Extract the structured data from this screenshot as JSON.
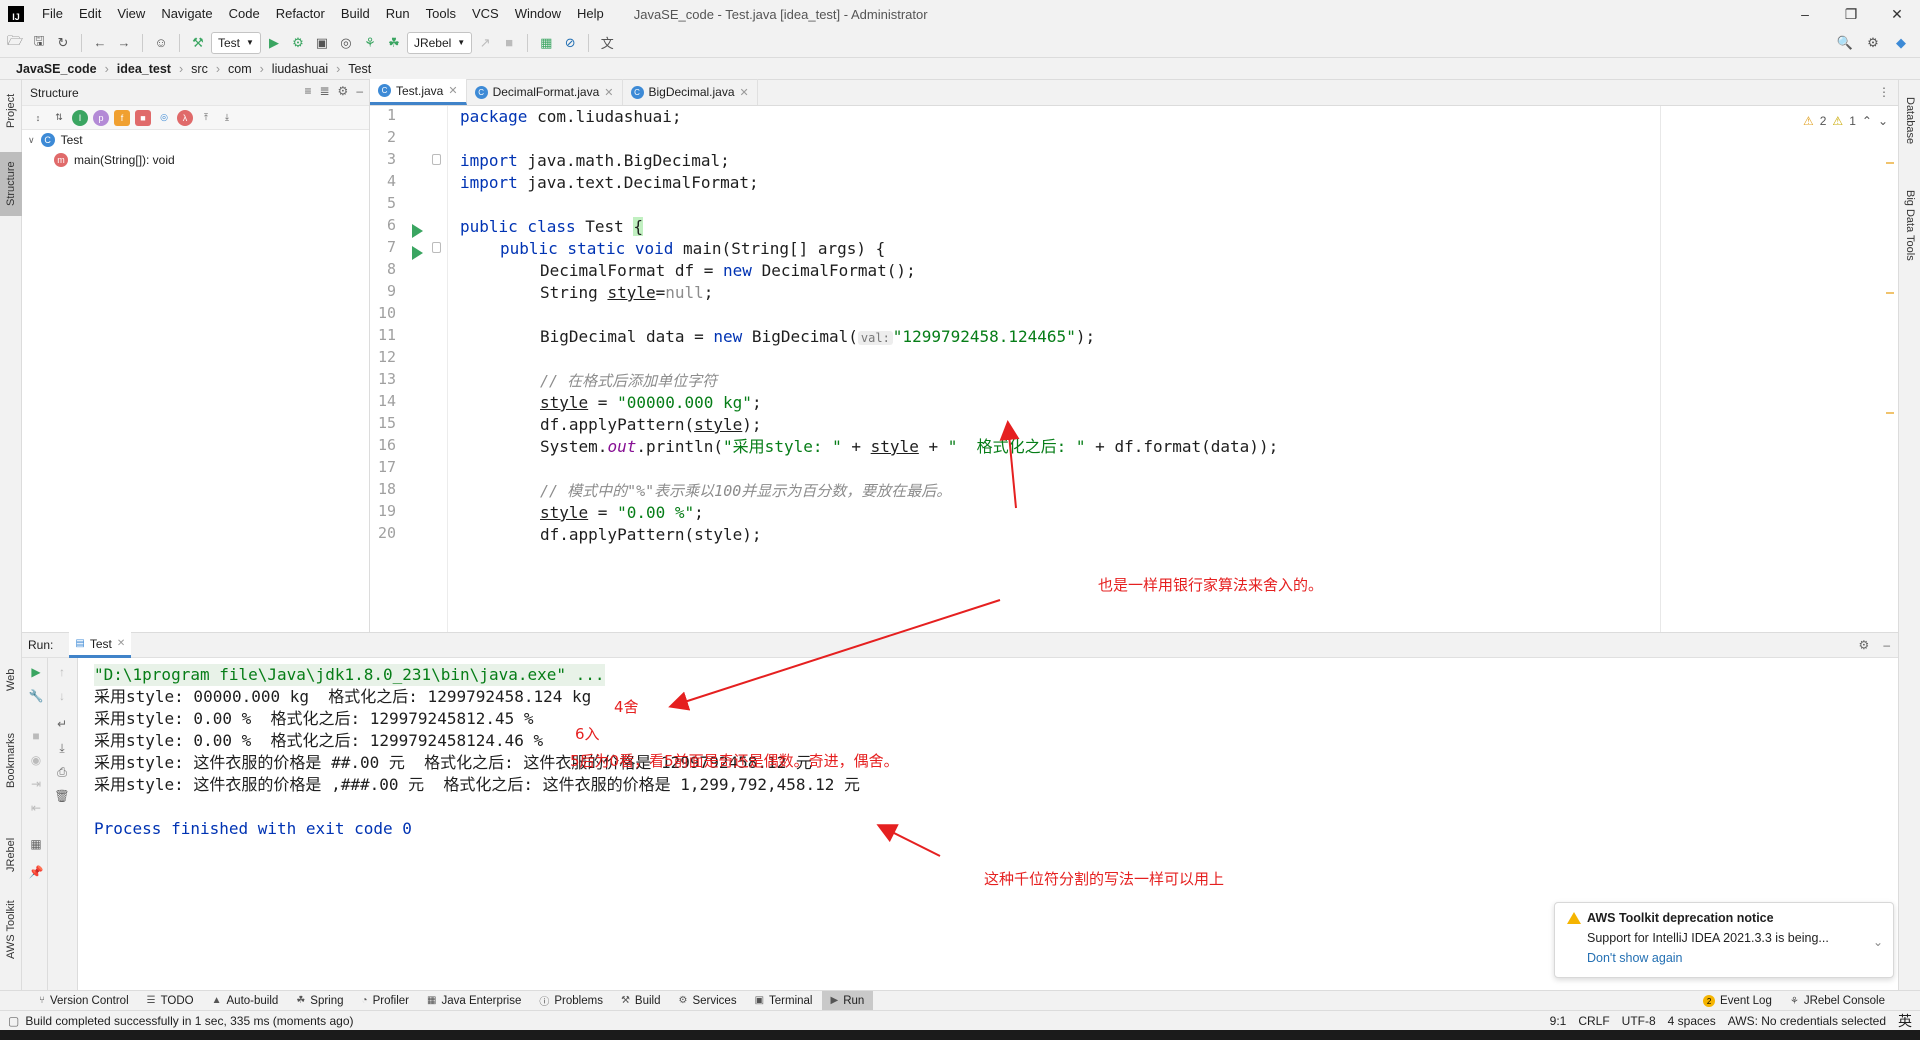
{
  "window": {
    "title": "JavaSE_code - Test.java [idea_test] - Administrator",
    "logo": "IJ"
  },
  "menu": [
    "File",
    "Edit",
    "View",
    "Navigate",
    "Code",
    "Refactor",
    "Build",
    "Run",
    "Tools",
    "VCS",
    "Window",
    "Help"
  ],
  "toolbar": {
    "run_config": "Test",
    "jrebel": "JRebel"
  },
  "breadcrumb": [
    "JavaSE_code",
    "idea_test",
    "src",
    "com",
    "liudashuai",
    "Test"
  ],
  "left_stripe": {
    "project": "Project",
    "structure": "Structure",
    "web": "Web",
    "bookmarks": "Bookmarks",
    "jrebel": "JRebel",
    "aws": "AWS Toolkit"
  },
  "right_stripe": {
    "database": "Database",
    "bigdata": "Big Data Tools"
  },
  "structure": {
    "title": "Structure",
    "root": "Test",
    "child": "main(String[]): void"
  },
  "editor": {
    "tabs": [
      "Test.java",
      "DecimalFormat.java",
      "BigDecimal.java"
    ],
    "inspections": {
      "warnings": "2",
      "weak": "1"
    },
    "line_numbers": [
      "1",
      "2",
      "3",
      "4",
      "5",
      "6",
      "7",
      "8",
      "9",
      "10",
      "11",
      "12",
      "13",
      "14",
      "15",
      "16",
      "17",
      "18",
      "19",
      "20"
    ],
    "code": {
      "l1_kw": "package",
      "l1_rest": " com.liudashuai;",
      "l3_kw": "import",
      "l3_rest": " java.math.BigDecimal;",
      "l4_kw": "import",
      "l4_rest": " java.text.DecimalFormat;",
      "l6_kw": "public class",
      "l6_name": " Test ",
      "l6_brace": "{",
      "l7_kw": "public static void",
      "l7_rest": " main(String[] args) {",
      "l8_a": "DecimalFormat df = ",
      "l8_kw": "new",
      "l8_b": " DecimalFormat();",
      "l9_a": "String ",
      "l9_var": "style",
      "l9_b": "=",
      "l9_null": "null",
      "l9_c": ";",
      "l11_a": "BigDecimal data = ",
      "l11_kw": "new",
      "l11_b": " BigDecimal(",
      "l11_hint": "val:",
      "l11_str": "\"1299792458.124465\"",
      "l11_c": ");",
      "l13": "// 在格式后添加单位字符",
      "l14_var": "style",
      "l14_a": " = ",
      "l14_str": "\"00000.000 kg\"",
      "l14_b": ";",
      "l15_a": "df.applyPattern(",
      "l15_var": "style",
      "l15_b": ");",
      "l16_a": "System.",
      "l16_out": "out",
      "l16_b": ".println(",
      "l16_s1": "\"采用style: \"",
      "l16_c": " + ",
      "l16_var": "style",
      "l16_d": " + ",
      "l16_s2": "\"  格式化之后: \"",
      "l16_e": " + df.format(data));",
      "l18": "// 模式中的\"%\"表示乘以100并显示为百分数，要放在最后。",
      "l19_var": "style",
      "l19_a": " = ",
      "l19_str": "\"0.00 %\"",
      "l19_b": ";",
      "l20": "df.applyPattern(style);"
    }
  },
  "run": {
    "label": "Run:",
    "tab": "Test",
    "output": [
      "\"D:\\1program file\\Java\\jdk1.8.0_231\\bin\\java.exe\" ...",
      "采用style: 00000.000 kg  格式化之后: 1299792458.124 kg",
      "采用style: 0.00 %  格式化之后: 129979245812.45 %",
      "采用style: 0.00 %  格式化之后: 1299792458124.46 %",
      "采用style: 这件衣服的价格是 ##.00 元  格式化之后: 这件衣服的价格是 1299792458.12 元",
      "采用style: 这件衣服的价格是 ,###.00 元  格式化之后: 这件衣服的价格是 1,299,792,458.12 元",
      "",
      "Process finished with exit code 0"
    ]
  },
  "annotations": {
    "bank_rounding": "也是一样用银行家算法来舍入的。",
    "four_she": "4舍",
    "six_ru": "6入",
    "five_rule": "5后为0看，看5前面是奇还是偶数。奇进，偶舍。",
    "thousands": "这种千位符分割的写法一样可以用上"
  },
  "notification": {
    "title": "AWS Toolkit deprecation notice",
    "body": "Support for IntelliJ IDEA 2021.3.3 is being...",
    "link": "Don't show again"
  },
  "bottom_tabs": [
    "Version Control",
    "TODO",
    "Auto-build",
    "Spring",
    "Profiler",
    "Java Enterprise",
    "Problems",
    "Build",
    "Services",
    "Terminal",
    "Run"
  ],
  "bottom_right": {
    "event_count": "2",
    "event_log": "Event Log",
    "jrebel_console": "JRebel Console"
  },
  "status": {
    "message": "Build completed successfully in 1 sec, 335 ms (moments ago)",
    "position": "9:1",
    "line_sep": "CRLF",
    "encoding": "UTF-8",
    "indent": "4 spaces",
    "aws": "AWS: No credentials selected",
    "ime": "英"
  }
}
